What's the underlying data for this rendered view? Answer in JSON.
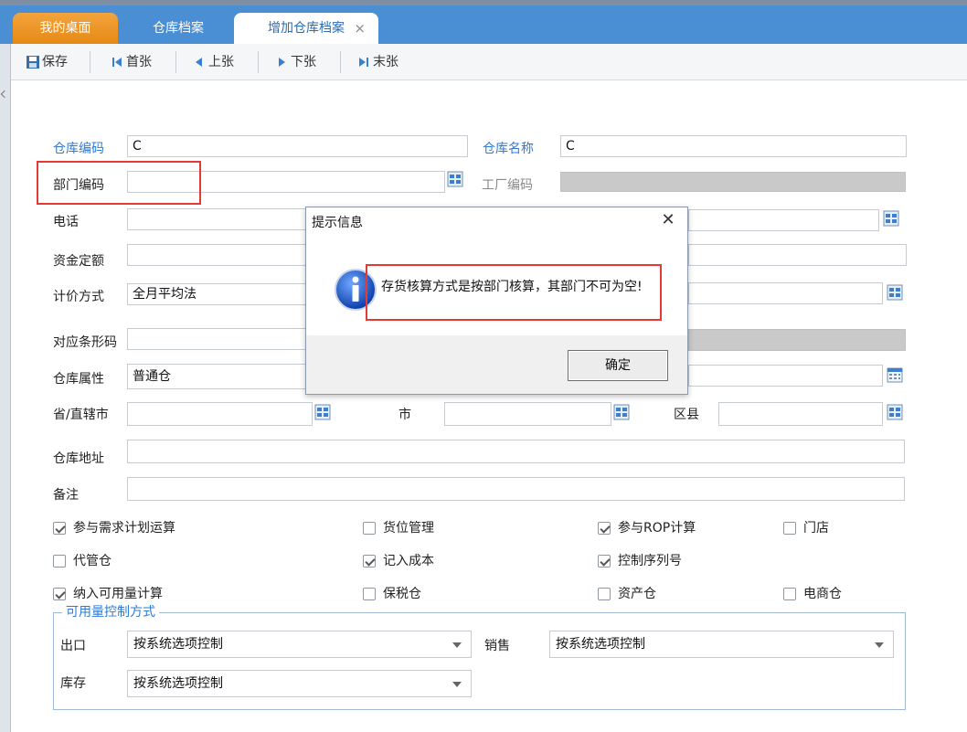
{
  "tabs": [
    {
      "label": "我的桌面"
    },
    {
      "label": "仓库档案"
    },
    {
      "label": "增加仓库档案",
      "close": "×"
    }
  ],
  "toolbar": {
    "save": "保存",
    "first": "首张",
    "prev": "上张",
    "next": "下张",
    "last": "末张"
  },
  "form": {
    "warehouse_code_label": "仓库编码",
    "warehouse_code_value": "C",
    "warehouse_name_label": "仓库名称",
    "warehouse_name_value": "C",
    "dept_code_label": "部门编码",
    "dept_code_value": "",
    "factory_code_label": "工厂编码",
    "phone_label": "电话",
    "fund_quota_label": "资金定额",
    "pricing_method_label": "计价方式",
    "pricing_method_value": "全月平均法",
    "barcode_label": "对应条形码",
    "warehouse_attr_label": "仓库属性",
    "warehouse_attr_value": "普通仓",
    "province_label": "省/直辖市",
    "city_label": "市",
    "district_label": "区县",
    "address_label": "仓库地址",
    "remark_label": "备注"
  },
  "checkboxes": [
    {
      "label": "参与需求计划运算",
      "checked": true
    },
    {
      "label": "货位管理",
      "checked": false
    },
    {
      "label": "参与ROP计算",
      "checked": true
    },
    {
      "label": "门店",
      "checked": false
    },
    {
      "label": "代管仓",
      "checked": false
    },
    {
      "label": "记入成本",
      "checked": true
    },
    {
      "label": "控制序列号",
      "checked": true
    },
    {
      "label": "纳入可用量计算",
      "checked": true
    },
    {
      "label": "保税仓",
      "checked": false
    },
    {
      "label": "资产仓",
      "checked": false
    },
    {
      "label": "电商仓",
      "checked": false
    }
  ],
  "availability": {
    "title": "可用量控制方式",
    "outbound_label": "出口",
    "outbound_value": "按系统选项控制",
    "sales_label": "销售",
    "sales_value": "按系统选项控制",
    "stock_label": "库存",
    "stock_value": "按系统选项控制"
  },
  "dialog": {
    "title": "提示信息",
    "message": "存货核算方式是按部门核算，其部门不可为空!",
    "ok": "确定"
  },
  "colors": {
    "tab_bar": "#4a8ed3",
    "active_desk_tab": "#e68915",
    "field_label_blue": "#2e7bd6",
    "highlight_red": "#e53935"
  }
}
